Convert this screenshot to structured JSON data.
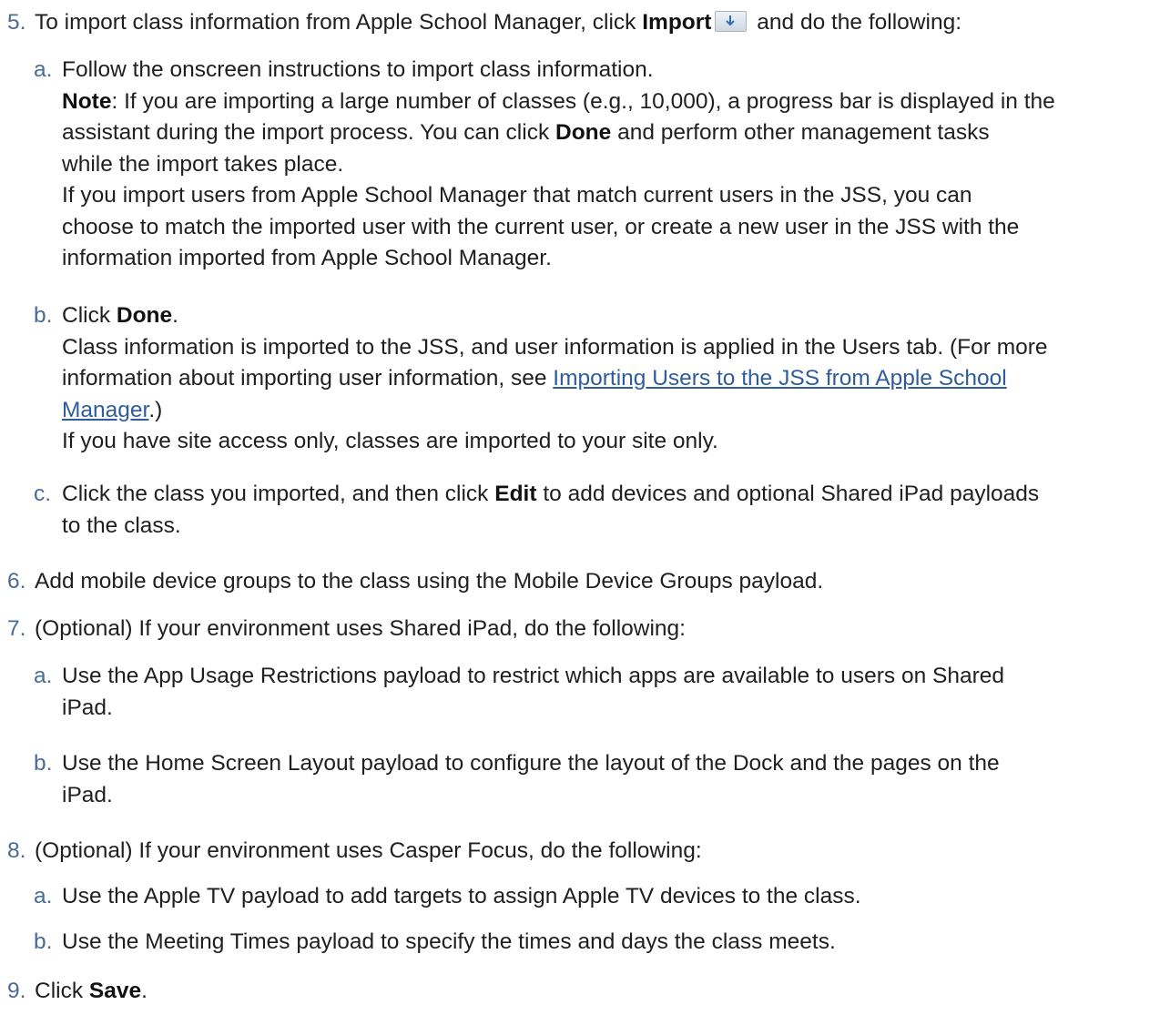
{
  "steps": {
    "s5": {
      "num": "5.",
      "pre": "To import class information from Apple School Manager, click ",
      "bold": "Import",
      "post": " and do the following:",
      "icon": "import-arrow-down-icon",
      "a": {
        "letter": "a.",
        "line1": "Follow the onscreen instructions to import class information.",
        "note_label": "Note",
        "note_text1": ": If you are importing a large number of classes (e.g., 10,000), a progress bar is displayed in the",
        "note_text2": "assistant during the import process. You can click ",
        "note_done": "Done",
        "note_text3": " and perform other management tasks",
        "note_text4": "while the import takes place.",
        "p2_1": "If you import users from Apple School Manager that match current users in the JSS, you can",
        "p2_2": "choose to match the imported user with the current user, or create a new user in the JSS with the",
        "p2_3": "information imported from Apple School Manager."
      },
      "b": {
        "letter": "b.",
        "pre": "Click ",
        "bold": "Done",
        "post": ".",
        "l2": "Class information is imported to the JSS, and user information is applied in the Users tab. (For more",
        "l3_pre": "information about importing user information, see ",
        "link1": "Importing Users to the JSS from Apple School",
        "link2": "Manager",
        "l4_post": ".)",
        "l5": "If you have site access only, classes are imported to your site only."
      },
      "c": {
        "letter": "c.",
        "pre": "Click the class you imported, and then click ",
        "bold": "Edit",
        "post": " to add devices and optional Shared iPad payloads",
        "l2": "to the class."
      }
    },
    "s6": {
      "num": "6.",
      "text": "Add mobile device groups to the class using the Mobile Device Groups payload."
    },
    "s7": {
      "num": "7.",
      "text": "(Optional) If your environment uses Shared iPad, do the following:",
      "a": {
        "letter": "a.",
        "l1": "Use the App Usage Restrictions payload to restrict which apps are available to users on Shared",
        "l2": "iPad."
      },
      "b": {
        "letter": "b.",
        "l1": "Use the Home Screen Layout payload to configure the layout of the Dock and the pages on the",
        "l2": "iPad."
      }
    },
    "s8": {
      "num": "8.",
      "text": "(Optional) If your environment uses Casper Focus, do the following:",
      "a": {
        "letter": "a.",
        "l1": "Use the Apple TV payload to add targets to assign Apple TV devices to the class."
      },
      "b": {
        "letter": "b.",
        "l1": "Use the Meeting Times payload to specify the times and days the class meets."
      }
    },
    "s9": {
      "num": "9.",
      "pre": "Click ",
      "bold": "Save",
      "post": "."
    }
  }
}
